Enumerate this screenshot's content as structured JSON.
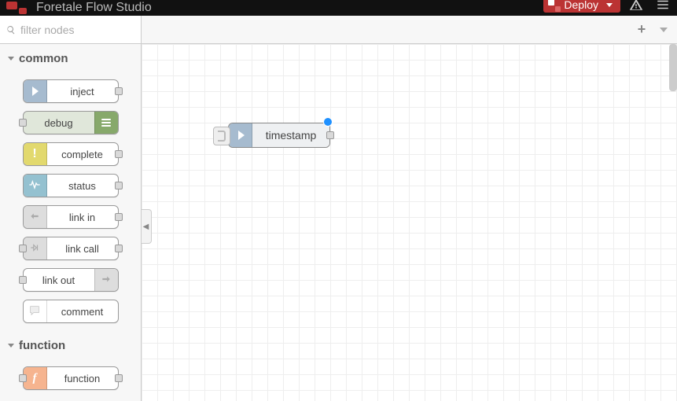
{
  "header": {
    "app_title": "Foretale Flow Studio",
    "deploy_label": "Deploy"
  },
  "sidebar": {
    "search_placeholder": "filter nodes",
    "categories": {
      "common": {
        "label": "common"
      },
      "function_": {
        "label": "function"
      }
    },
    "nodes": {
      "inject": {
        "label": "inject"
      },
      "debug": {
        "label": "debug"
      },
      "complete": {
        "label": "complete"
      },
      "status": {
        "label": "status"
      },
      "link_in": {
        "label": "link in"
      },
      "link_call": {
        "label": "link call"
      },
      "link_out": {
        "label": "link out"
      },
      "comment": {
        "label": "comment"
      },
      "function_": {
        "label": "function"
      }
    }
  },
  "canvas": {
    "node0": {
      "label": "timestamp"
    }
  },
  "colors": {
    "deploy": "#b33333",
    "inject": "#a6bbcf",
    "debug": "#87a96b",
    "complete": "#e2d96e",
    "status": "#94c1d0",
    "link": "#dddddd",
    "function_": "#f6b48f",
    "changed_dot": "#1e90ff"
  }
}
